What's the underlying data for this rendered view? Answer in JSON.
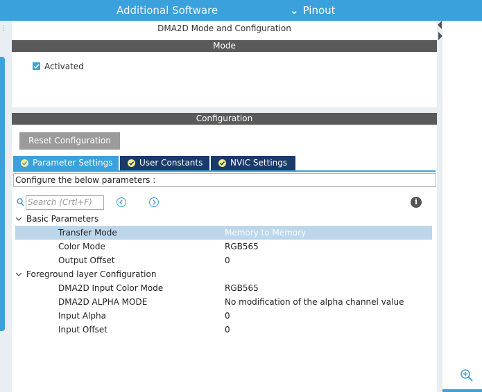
{
  "header": {
    "additional_software": "Additional Software",
    "pinout": "Pinout"
  },
  "panel": {
    "title": "DMA2D Mode and Configuration",
    "mode_section": "Mode",
    "activated_label": "Activated",
    "configuration_section": "Configuration",
    "reset_button": "Reset Configuration"
  },
  "tabs": [
    {
      "label": "Parameter Settings",
      "active": true
    },
    {
      "label": "User Constants",
      "active": false
    },
    {
      "label": "NVIC Settings",
      "active": false
    }
  ],
  "info_text": "Configure the below parameters :",
  "search": {
    "placeholder": "Search (Crtl+F)"
  },
  "groups": [
    {
      "name": "Basic Parameters",
      "params": [
        {
          "name": "Transfer Mode",
          "value": "Memory to Memory"
        },
        {
          "name": "Color Mode",
          "value": "RGB565"
        },
        {
          "name": "Output Offset",
          "value": "0"
        }
      ]
    },
    {
      "name": "Foreground layer Configuration",
      "params": [
        {
          "name": "DMA2D Input Color Mode",
          "value": "RGB565"
        },
        {
          "name": "DMA2D ALPHA MODE",
          "value": "No modification of the alpha channel value"
        },
        {
          "name": "Input Alpha",
          "value": "0"
        },
        {
          "name": "Input Offset",
          "value": "0"
        }
      ]
    }
  ],
  "colors": {
    "accent": "#3aa1dc",
    "tab_inactive": "#1a3a6b",
    "section_bar": "#5a5a5a",
    "selected_row": "#bcd7ec"
  }
}
